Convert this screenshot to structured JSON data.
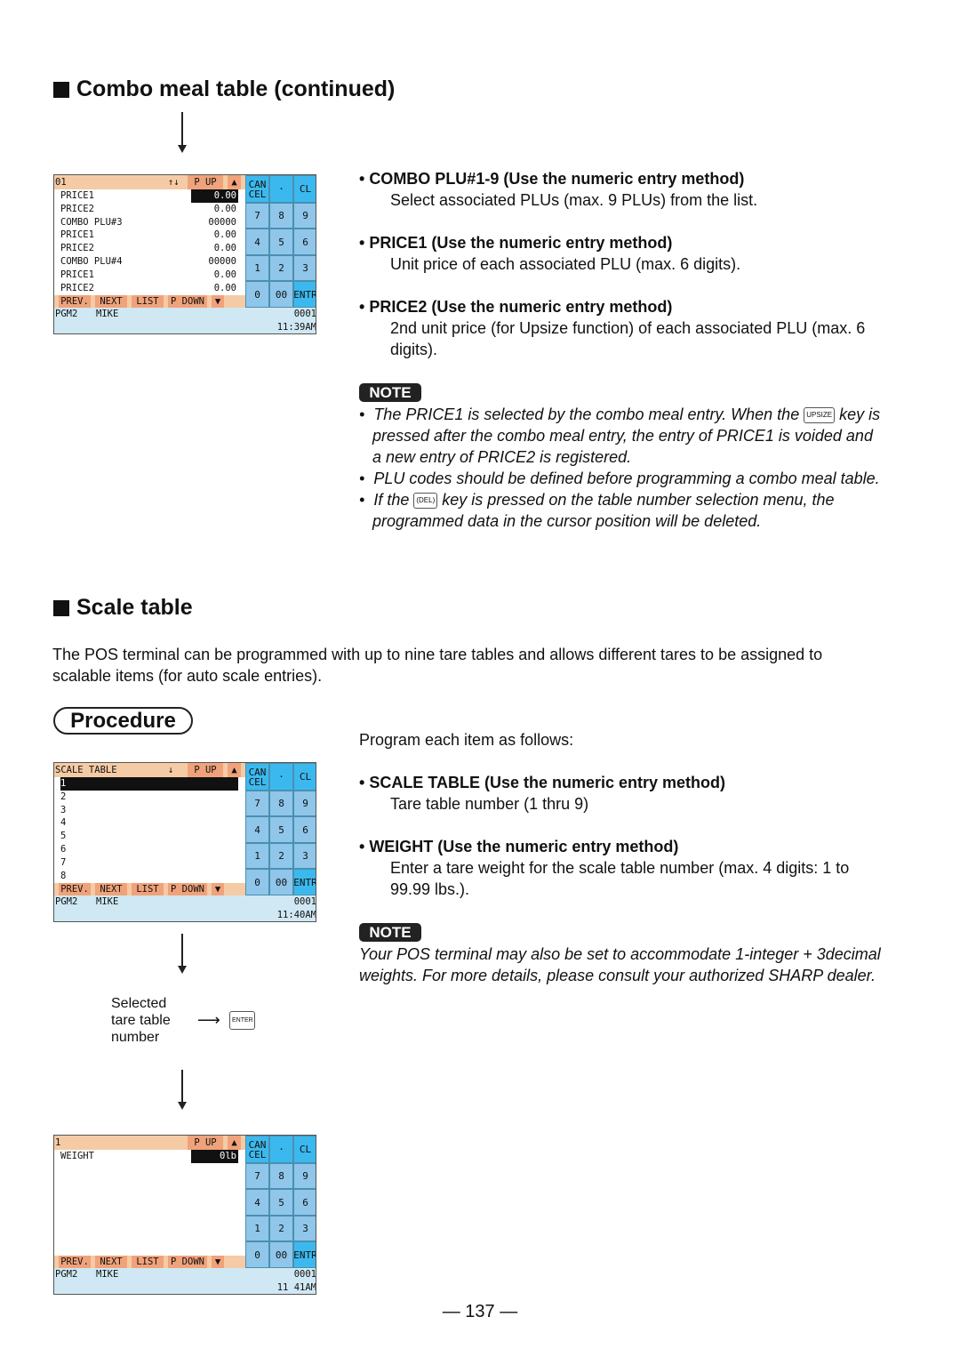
{
  "section1": {
    "title": "Combo meal table (continued)",
    "items": [
      {
        "heading": "COMBO PLU#1-9 (Use the numeric entry method)",
        "desc": [
          "Select associated PLUs (max. 9 PLUs) from the list."
        ]
      },
      {
        "heading": "PRICE1 (Use the numeric entry method)",
        "desc": [
          "Unit price of each associated PLU (max. 6 digits)."
        ]
      },
      {
        "heading": "PRICE2 (Use the numeric entry method)",
        "desc": [
          "2nd unit price (for Upsize function) of each associated PLU (max. 6",
          "digits)."
        ]
      }
    ],
    "note_label": "NOTE",
    "notes": {
      "n1a": "The PRICE1 is selected by the combo meal entry. When the",
      "key1": "UPSIZE",
      "n1b": "key is",
      "n1c": "pressed after the combo meal entry, the entry of PRICE1 is voided and",
      "n1d": "a new entry of PRICE2 is registered.",
      "n2": "PLU codes should be defined before programming a combo meal table.",
      "n3a": "If the",
      "key2": "(DEL)",
      "n3b": "key is pressed on the table number selection menu, the",
      "n3c": "programmed data in the cursor position will be deleted."
    }
  },
  "section2": {
    "title": "Scale table",
    "intro": [
      "The POS terminal can be programmed with up to nine tare tables and allows different tares to be assigned to",
      "scalable items (for auto scale entries)."
    ],
    "procedure": "Procedure",
    "program_each": "Program each item as follows:",
    "items": [
      {
        "heading": "SCALE TABLE (Use the numeric entry method)",
        "desc": [
          "Tare table number (1 thru 9)"
        ]
      },
      {
        "heading": "WEIGHT (Use the numeric entry method)",
        "desc": [
          "Enter a tare weight for the scale table number (max. 4 digits: 1 to",
          "99.99 lbs.)."
        ]
      }
    ],
    "note_label": "NOTE",
    "note": [
      "Your POS terminal may also be set to accommodate 1-integer + 3decimal",
      "weights. For more details, please consult your authorized SHARP dealer."
    ],
    "selected_label": [
      "Selected",
      "tare table",
      "number"
    ],
    "enter_key": "ENTER"
  },
  "screens": [
    {
      "title": "01",
      "arrows": "↑↓",
      "rows": [
        {
          "label": "PRICE1",
          "value": "0.00",
          "hl": true
        },
        {
          "label": "PRICE2",
          "value": "0.00"
        },
        {
          "label": "COMBO PLU#3",
          "value": "00000"
        },
        {
          "label": "PRICE1",
          "value": "0.00"
        },
        {
          "label": "PRICE2",
          "value": "0.00"
        },
        {
          "label": "COMBO PLU#4",
          "value": "00000"
        },
        {
          "label": "PRICE1",
          "value": "0.00"
        },
        {
          "label": "PRICE2",
          "value": "0.00"
        }
      ],
      "status": {
        "pgm": "PGM2",
        "user": "MIKE",
        "num": "0001",
        "time": "11:39AM"
      }
    },
    {
      "title": "SCALE TABLE",
      "arrows": "↓",
      "rows": [
        {
          "label": "1",
          "rowhl": true
        },
        {
          "label": "2"
        },
        {
          "label": "3"
        },
        {
          "label": "4"
        },
        {
          "label": "5"
        },
        {
          "label": "6"
        },
        {
          "label": "7"
        },
        {
          "label": "8"
        }
      ],
      "status": {
        "pgm": "PGM2",
        "user": "MIKE",
        "num": "0001",
        "time": "11:40AM"
      }
    },
    {
      "title": "1",
      "arrows": "",
      "rows": [
        {
          "label": "WEIGHT",
          "value": "0lb",
          "hl": true
        }
      ],
      "status": {
        "pgm": "PGM2",
        "user": "MIKE",
        "num": "0001",
        "time": "11 41AM"
      }
    }
  ],
  "screen_common": {
    "pup": "P UP",
    "up": "▲",
    "footer": [
      "PREV.",
      "NEXT",
      "LIST",
      "P DOWN",
      "▼"
    ],
    "keys": [
      "CAN CEL",
      "·",
      "CL",
      "7",
      "8",
      "9",
      "4",
      "5",
      "6",
      "1",
      "2",
      "3",
      "0",
      "00",
      "ENTR"
    ]
  },
  "page_number": "— 137 —"
}
